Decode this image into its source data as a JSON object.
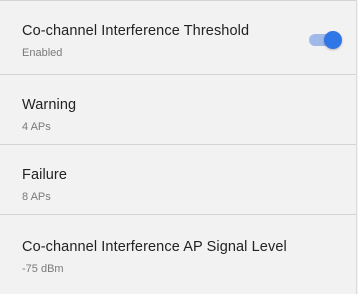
{
  "settings": {
    "interference_threshold": {
      "title": "Co-channel Interference Threshold",
      "status": "Enabled",
      "toggle_on": true,
      "toggle_color": "#2f76e6"
    },
    "warning": {
      "title": "Warning",
      "value": "4 APs"
    },
    "failure": {
      "title": "Failure",
      "value": "8 APs"
    },
    "signal_level": {
      "title": "Co-channel Interference AP Signal Level",
      "value": "-75 dBm"
    }
  }
}
